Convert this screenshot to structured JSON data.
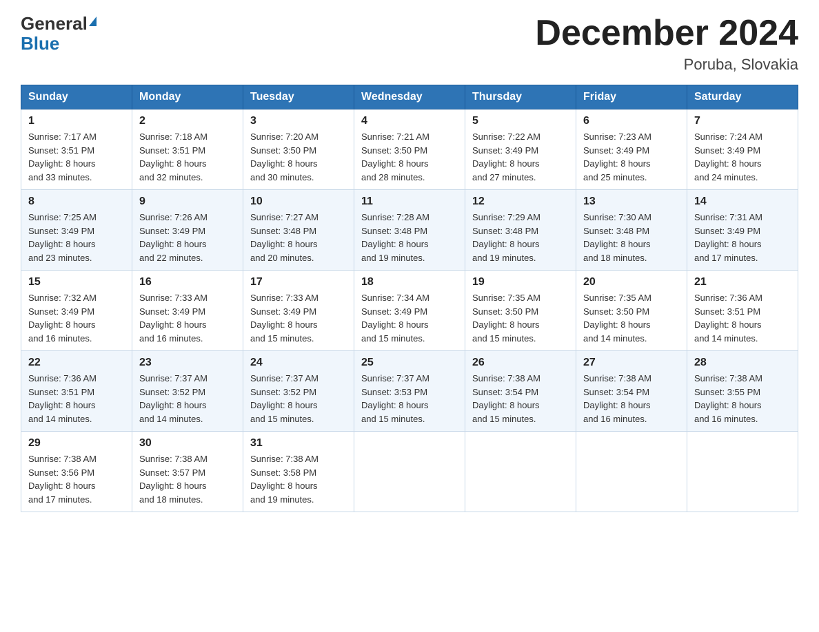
{
  "header": {
    "logo_general": "General",
    "logo_blue": "Blue",
    "title": "December 2024",
    "subtitle": "Poruba, Slovakia"
  },
  "weekdays": [
    "Sunday",
    "Monday",
    "Tuesday",
    "Wednesday",
    "Thursday",
    "Friday",
    "Saturday"
  ],
  "weeks": [
    [
      {
        "day": "1",
        "sunrise": "7:17 AM",
        "sunset": "3:51 PM",
        "daylight": "8 hours and 33 minutes."
      },
      {
        "day": "2",
        "sunrise": "7:18 AM",
        "sunset": "3:51 PM",
        "daylight": "8 hours and 32 minutes."
      },
      {
        "day": "3",
        "sunrise": "7:20 AM",
        "sunset": "3:50 PM",
        "daylight": "8 hours and 30 minutes."
      },
      {
        "day": "4",
        "sunrise": "7:21 AM",
        "sunset": "3:50 PM",
        "daylight": "8 hours and 28 minutes."
      },
      {
        "day": "5",
        "sunrise": "7:22 AM",
        "sunset": "3:49 PM",
        "daylight": "8 hours and 27 minutes."
      },
      {
        "day": "6",
        "sunrise": "7:23 AM",
        "sunset": "3:49 PM",
        "daylight": "8 hours and 25 minutes."
      },
      {
        "day": "7",
        "sunrise": "7:24 AM",
        "sunset": "3:49 PM",
        "daylight": "8 hours and 24 minutes."
      }
    ],
    [
      {
        "day": "8",
        "sunrise": "7:25 AM",
        "sunset": "3:49 PM",
        "daylight": "8 hours and 23 minutes."
      },
      {
        "day": "9",
        "sunrise": "7:26 AM",
        "sunset": "3:49 PM",
        "daylight": "8 hours and 22 minutes."
      },
      {
        "day": "10",
        "sunrise": "7:27 AM",
        "sunset": "3:48 PM",
        "daylight": "8 hours and 20 minutes."
      },
      {
        "day": "11",
        "sunrise": "7:28 AM",
        "sunset": "3:48 PM",
        "daylight": "8 hours and 19 minutes."
      },
      {
        "day": "12",
        "sunrise": "7:29 AM",
        "sunset": "3:48 PM",
        "daylight": "8 hours and 19 minutes."
      },
      {
        "day": "13",
        "sunrise": "7:30 AM",
        "sunset": "3:48 PM",
        "daylight": "8 hours and 18 minutes."
      },
      {
        "day": "14",
        "sunrise": "7:31 AM",
        "sunset": "3:49 PM",
        "daylight": "8 hours and 17 minutes."
      }
    ],
    [
      {
        "day": "15",
        "sunrise": "7:32 AM",
        "sunset": "3:49 PM",
        "daylight": "8 hours and 16 minutes."
      },
      {
        "day": "16",
        "sunrise": "7:33 AM",
        "sunset": "3:49 PM",
        "daylight": "8 hours and 16 minutes."
      },
      {
        "day": "17",
        "sunrise": "7:33 AM",
        "sunset": "3:49 PM",
        "daylight": "8 hours and 15 minutes."
      },
      {
        "day": "18",
        "sunrise": "7:34 AM",
        "sunset": "3:49 PM",
        "daylight": "8 hours and 15 minutes."
      },
      {
        "day": "19",
        "sunrise": "7:35 AM",
        "sunset": "3:50 PM",
        "daylight": "8 hours and 15 minutes."
      },
      {
        "day": "20",
        "sunrise": "7:35 AM",
        "sunset": "3:50 PM",
        "daylight": "8 hours and 14 minutes."
      },
      {
        "day": "21",
        "sunrise": "7:36 AM",
        "sunset": "3:51 PM",
        "daylight": "8 hours and 14 minutes."
      }
    ],
    [
      {
        "day": "22",
        "sunrise": "7:36 AM",
        "sunset": "3:51 PM",
        "daylight": "8 hours and 14 minutes."
      },
      {
        "day": "23",
        "sunrise": "7:37 AM",
        "sunset": "3:52 PM",
        "daylight": "8 hours and 14 minutes."
      },
      {
        "day": "24",
        "sunrise": "7:37 AM",
        "sunset": "3:52 PM",
        "daylight": "8 hours and 15 minutes."
      },
      {
        "day": "25",
        "sunrise": "7:37 AM",
        "sunset": "3:53 PM",
        "daylight": "8 hours and 15 minutes."
      },
      {
        "day": "26",
        "sunrise": "7:38 AM",
        "sunset": "3:54 PM",
        "daylight": "8 hours and 15 minutes."
      },
      {
        "day": "27",
        "sunrise": "7:38 AM",
        "sunset": "3:54 PM",
        "daylight": "8 hours and 16 minutes."
      },
      {
        "day": "28",
        "sunrise": "7:38 AM",
        "sunset": "3:55 PM",
        "daylight": "8 hours and 16 minutes."
      }
    ],
    [
      {
        "day": "29",
        "sunrise": "7:38 AM",
        "sunset": "3:56 PM",
        "daylight": "8 hours and 17 minutes."
      },
      {
        "day": "30",
        "sunrise": "7:38 AM",
        "sunset": "3:57 PM",
        "daylight": "8 hours and 18 minutes."
      },
      {
        "day": "31",
        "sunrise": "7:38 AM",
        "sunset": "3:58 PM",
        "daylight": "8 hours and 19 minutes."
      },
      null,
      null,
      null,
      null
    ]
  ],
  "labels": {
    "sunrise": "Sunrise:",
    "sunset": "Sunset:",
    "daylight": "Daylight:"
  }
}
